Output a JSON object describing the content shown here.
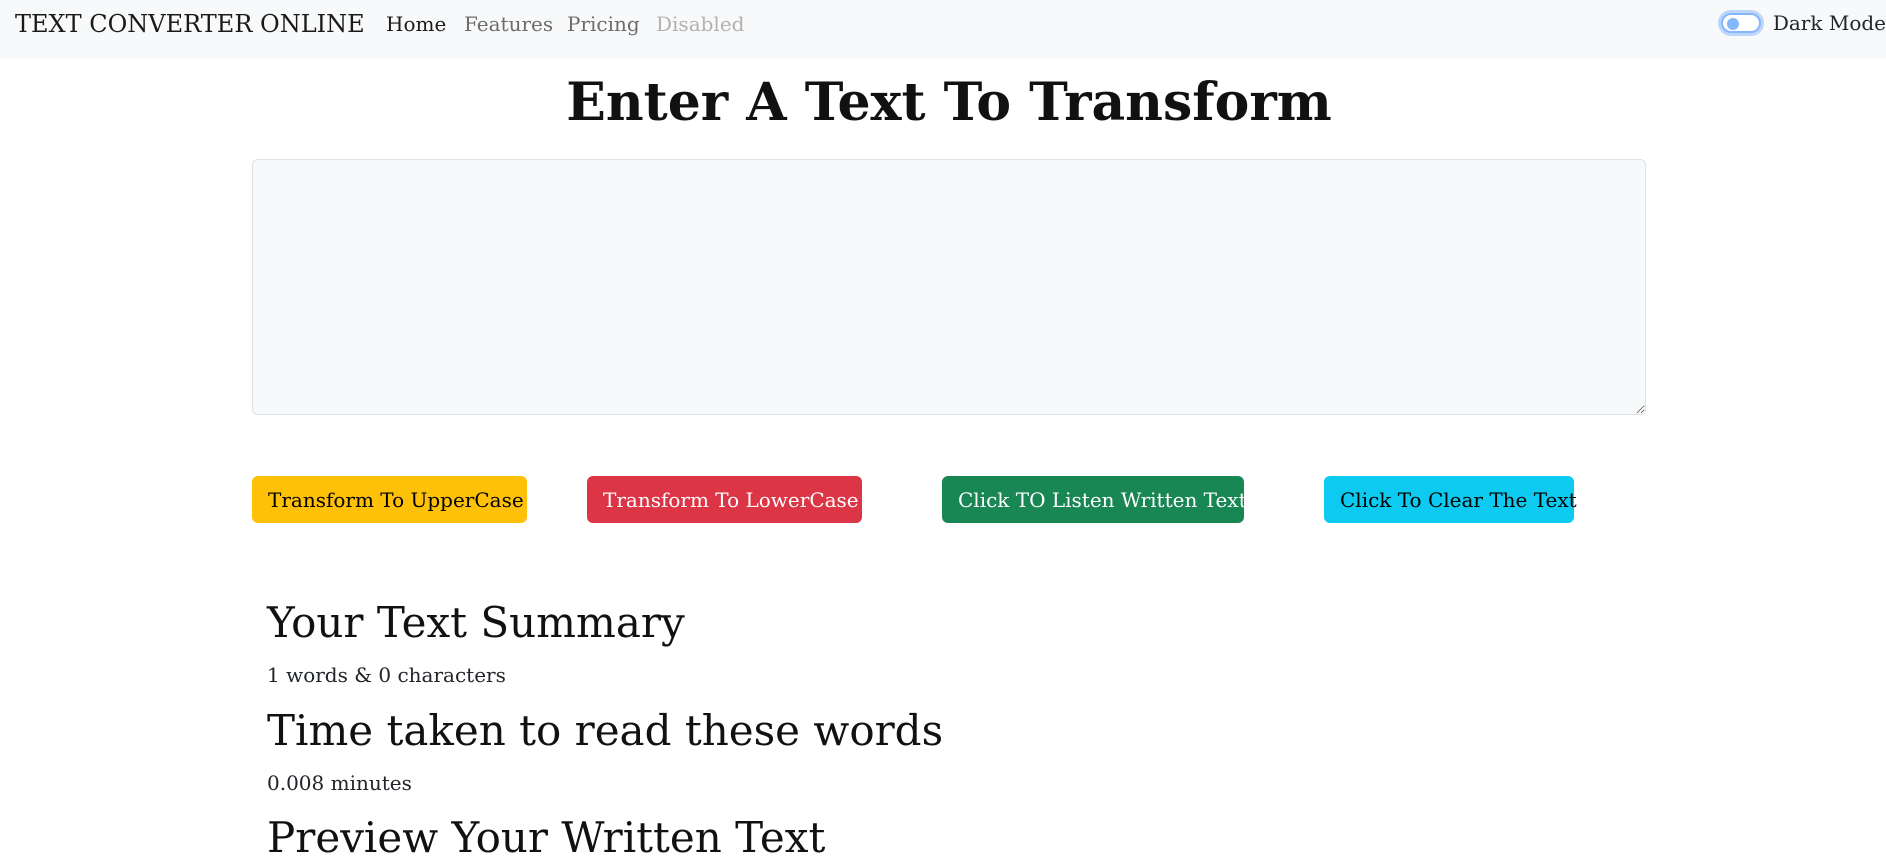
{
  "navbar": {
    "brand": "TEXT CONVERTER ONLINE",
    "links": [
      {
        "label": "Home",
        "state": "active"
      },
      {
        "label": "Features",
        "state": "normal"
      },
      {
        "label": "Pricing",
        "state": "normal"
      },
      {
        "label": "Disabled",
        "state": "disabled"
      }
    ],
    "dark_mode_label": "Dark Mode",
    "dark_mode_on": false
  },
  "main": {
    "heading": "Enter A Text To Transform",
    "textarea_value": "",
    "buttons": {
      "uppercase": "Transform To UpperCase",
      "lowercase": "Transform To LowerCase",
      "listen": "Click TO Listen Written Text",
      "clear": "Click To Clear The Text"
    }
  },
  "summary": {
    "title": "Your Text Summary",
    "counts": "1 words & 0 characters",
    "read_time_title": "Time taken to read these words",
    "read_time": "0.008 minutes",
    "preview_title": "Preview Your Written Text"
  },
  "colors": {
    "navbar_bg": "#f8f9fa",
    "warning": "#ffc107",
    "danger": "#dc3545",
    "success": "#198754",
    "info": "#0dcaf0"
  }
}
